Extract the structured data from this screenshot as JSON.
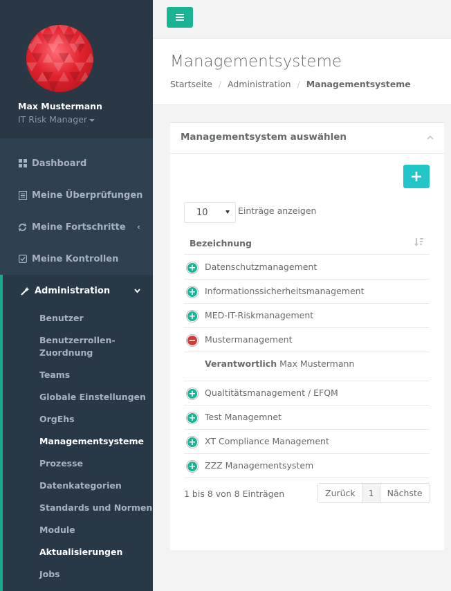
{
  "profile": {
    "name": "Max Mustermann",
    "role": "IT Risk Manager"
  },
  "nav": [
    {
      "label": "Dashboard",
      "icon": "dashboard-icon"
    },
    {
      "label": "Meine Überprüfungen",
      "icon": "list-icon"
    },
    {
      "label": "Meine Fortschritte",
      "icon": "refresh-icon"
    },
    {
      "label": "Meine Kontrollen",
      "icon": "checkbox-icon"
    },
    {
      "label": "Administration",
      "icon": "magic-wand-icon"
    }
  ],
  "submenu": [
    "Benutzer",
    "Benutzerrollen-",
    "Zuordnung",
    "Teams",
    "Globale Einstellungen",
    "OrgEhs",
    "Managementsysteme",
    "Prozesse",
    "Datenkategorien",
    "Standards und Normen",
    "Module",
    "Aktualisierungen",
    "Jobs"
  ],
  "header": {
    "title": "Managementsysteme",
    "breadcrumb": [
      "Startseite",
      "Administration",
      "Managementsysteme"
    ]
  },
  "panel": {
    "title": "Managementsystem auswählen",
    "add_label": "+",
    "page_length": "10",
    "length_label": "Einträge anzeigen",
    "column_header": "Bezeichnung",
    "rows": [
      "Datenschutzmanagement",
      "Informationssicherheitsmanagement",
      "MED-IT-Riskmanagement",
      "Mustermanagement",
      "Qualtitätsmanagement / EFQM",
      "Test Managemnet",
      "XT Compliance Management",
      "ZZZ Managementsystem"
    ],
    "detail": {
      "key": "Verantwortlich",
      "value": "Max Mustermann"
    },
    "info": "1 bis 8 von 8 Einträgen",
    "pager": {
      "prev": "Zurück",
      "current": "1",
      "next": "Nächste"
    }
  },
  "colors": {
    "accent": "#1ab394",
    "sidebar": "#2f4050",
    "info": "#23c6c8",
    "danger": "#d33a3a"
  }
}
